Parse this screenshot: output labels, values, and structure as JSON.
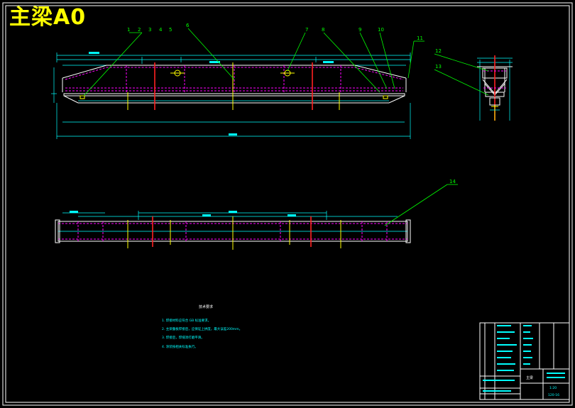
{
  "drawing": {
    "title": "主梁A0"
  },
  "balloons": [
    "1",
    "2",
    "3",
    "4",
    "5",
    "6",
    "7",
    "8",
    "9",
    "10",
    "11",
    "12",
    "13",
    "14"
  ],
  "notes": {
    "heading": "技术要求",
    "items": [
      "1. 焊接材料应符合 GB 标准要求。",
      "2. 主梁腹板焊接后，应保证上拱度，最大误差200mm。",
      "3. 焊接后，焊缝须打磨平滑。",
      "4. 涂装按相关标准执行。"
    ]
  },
  "titleblock": {
    "name": "主梁",
    "drawing_no": "120-16",
    "scale": "1:20"
  }
}
